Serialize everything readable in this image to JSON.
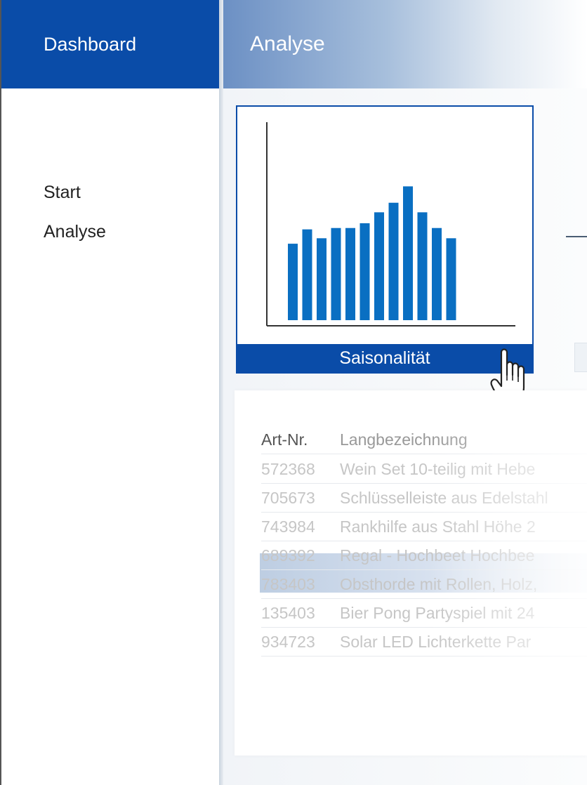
{
  "sidebar": {
    "brand": "Dashboard",
    "items": [
      {
        "label": "Start"
      },
      {
        "label": "Analyse"
      }
    ]
  },
  "header": {
    "title": "Analyse"
  },
  "chart_card": {
    "label": "Saisonalität",
    "chart_data": {
      "type": "bar",
      "values": [
        112,
        133,
        120,
        135,
        135,
        142,
        158,
        172,
        196,
        158,
        135,
        120
      ],
      "ylim": [
        0,
        290
      ],
      "color": "#0a6fc2",
      "axis_color": "#333333"
    }
  },
  "table": {
    "columns": [
      "Art-Nr.",
      "Langbezeichnung"
    ],
    "rows": [
      [
        "572368",
        "Wein Set 10-teilig mit Hebe"
      ],
      [
        "705673",
        "Schlüsselleiste aus Edelstahl"
      ],
      [
        "743984",
        "Rankhilfe aus Stahl Höhe 2"
      ],
      [
        "689392",
        "Regal - Hochbeet Hochbee"
      ],
      [
        "783403",
        "Obsthorde mit Rollen, Holz,"
      ],
      [
        "135403",
        "Bier Pong Partyspiel mit 24"
      ],
      [
        "934723",
        "Solar LED Lichterkette Par"
      ]
    ]
  },
  "colors": {
    "brand": "#0a4ca8",
    "bar": "#0a6fc2"
  }
}
